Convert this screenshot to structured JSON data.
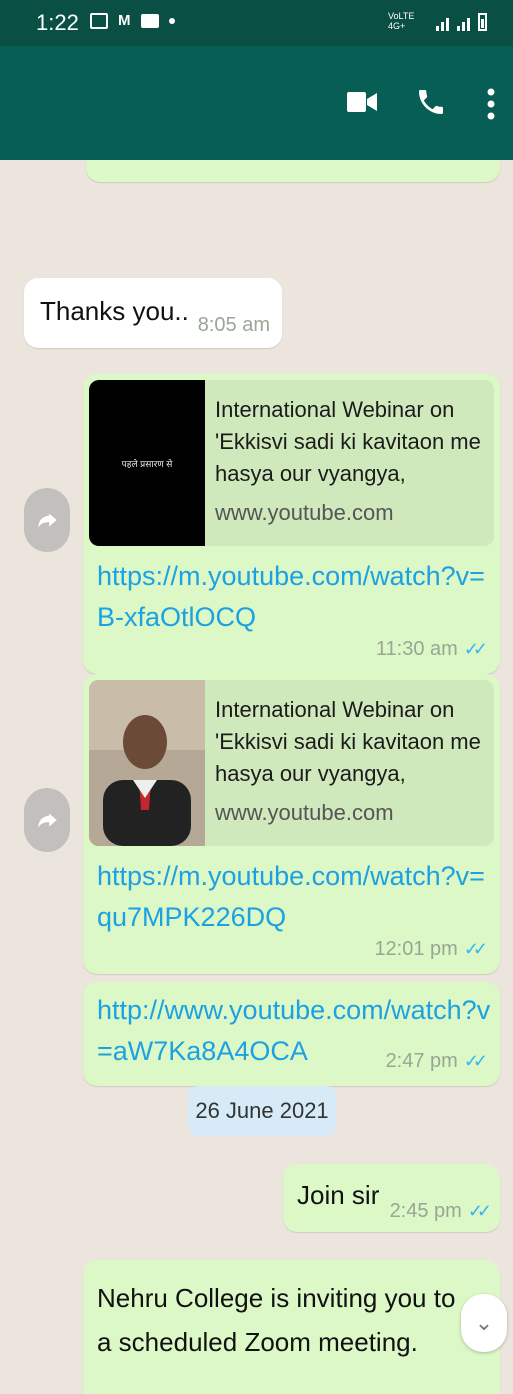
{
  "status_bar": {
    "time": "1:22",
    "network_label": "VoLTE 4G+",
    "mail_icon": "gmail-icon"
  },
  "app_bar": {
    "icons": [
      "video-call-icon",
      "voice-call-icon",
      "more-options-icon"
    ]
  },
  "messages": [
    {
      "type": "incoming",
      "text": "Thanks you..",
      "time": "8:05 am"
    },
    {
      "type": "outgoing-link",
      "preview_title": "International Webinar on 'Ekkisvi sadi ki kavitaon me hasya our vyangya, Resourc...",
      "preview_domain": "www.youtube.com",
      "thumbnail_text": "पहले प्रसारण से",
      "link": "https://m.youtube.com/watch?v=B-xfaOtlOCQ",
      "time": "11:30 am"
    },
    {
      "type": "outgoing-link",
      "preview_title": "International Webinar on 'Ekkisvi sadi ki kavitaon me hasya our vyangya, Resourc...",
      "preview_domain": "www.youtube.com",
      "link": "https://m.youtube.com/watch?v=qu7MPK226DQ",
      "time": "12:01 pm"
    },
    {
      "type": "outgoing-link",
      "link": "http://www.youtube.com/watch?v=aW7Ka8A4OCA",
      "time": "2:47 pm"
    },
    {
      "type": "date",
      "text": "26 June 2021"
    },
    {
      "type": "outgoing",
      "text": "Join sir",
      "time": "2:45 pm"
    },
    {
      "type": "outgoing",
      "text": "Nehru College is inviting you to a scheduled Zoom meeting."
    }
  ],
  "colors": {
    "header": "#075e54",
    "outgoing_bubble": "#dcf8c6",
    "incoming_bubble": "#ffffff",
    "link": "#1da1e2",
    "read_ticks": "#34b7f1"
  },
  "tick_glyph": "✓✓"
}
